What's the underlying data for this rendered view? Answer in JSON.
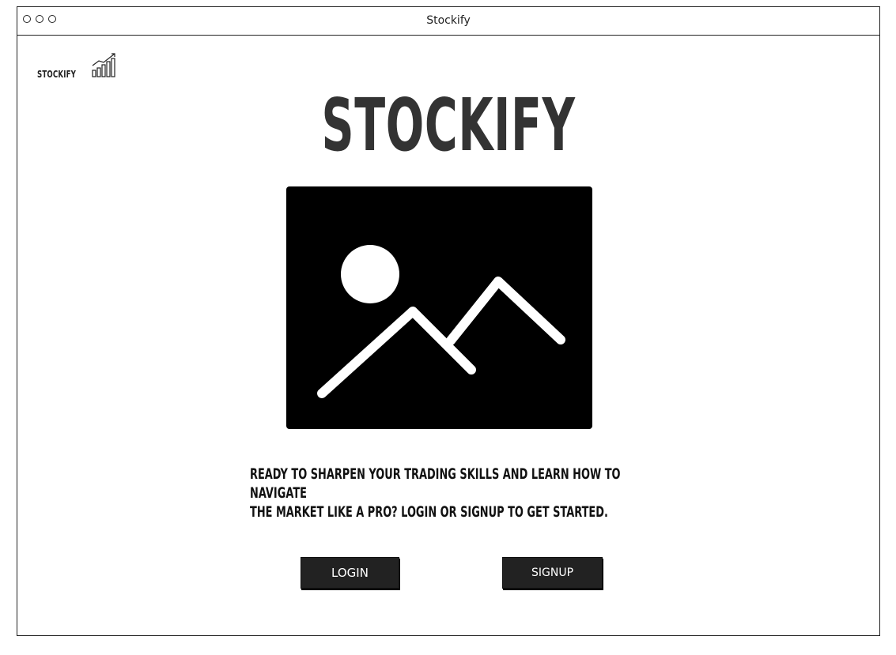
{
  "window": {
    "title": "Stockify"
  },
  "brand": {
    "name": "STOCKIFY",
    "icon": "bar-chart-trend-icon"
  },
  "hero": {
    "title": "STOCKIFY",
    "image_icon": "image-placeholder-icon"
  },
  "tagline": {
    "line1": "READY TO SHARPEN YOUR TRADING SKILLS AND LEARN HOW TO NAVIGATE",
    "line2": "THE MARKET LIKE A PRO? LOGIN OR SIGNUP TO GET STARTED."
  },
  "actions": {
    "login_label": "LOGIN",
    "signup_label": "SIGNUP"
  },
  "colors": {
    "button_bg": "#222222",
    "button_text": "#ffffff",
    "image_bg": "#000000",
    "title_text": "#333333"
  }
}
